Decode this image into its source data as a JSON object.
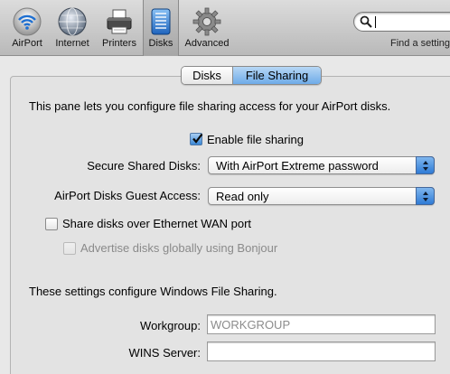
{
  "toolbar": {
    "items": [
      {
        "label": "AirPort",
        "icon": "airport-icon"
      },
      {
        "label": "Internet",
        "icon": "internet-globe-icon"
      },
      {
        "label": "Printers",
        "icon": "printer-icon"
      },
      {
        "label": "Disks",
        "icon": "disk-icon",
        "selected": true
      },
      {
        "label": "Advanced",
        "icon": "gear-icon"
      }
    ],
    "search": {
      "value": "",
      "hint": "Find a setting"
    }
  },
  "tabs": [
    {
      "label": "Disks",
      "selected": false
    },
    {
      "label": "File Sharing",
      "selected": true
    }
  ],
  "panel": {
    "description": "This pane lets you configure file sharing access for your AirPort disks.",
    "enable_file_sharing": {
      "label": "Enable file sharing",
      "checked": true
    },
    "secure_shared_disks": {
      "label": "Secure Shared Disks:",
      "value": "With AirPort Extreme password"
    },
    "guest_access": {
      "label": "AirPort Disks Guest Access:",
      "value": "Read only"
    },
    "share_wan": {
      "label": "Share disks over Ethernet WAN port",
      "checked": false
    },
    "advertise_bonjour": {
      "label": "Advertise disks globally using Bonjour",
      "checked": false,
      "enabled": false
    },
    "windows_description": "These settings configure Windows File Sharing.",
    "workgroup": {
      "label": "Workgroup:",
      "value": "",
      "placeholder": "WORKGROUP"
    },
    "wins_server": {
      "label": "WINS Server:",
      "value": ""
    }
  },
  "colors": {
    "accent": "#3a87d6",
    "selected_tab": "#6eabe8"
  }
}
